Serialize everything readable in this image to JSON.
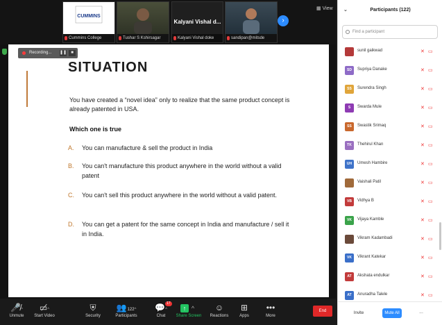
{
  "top_strip": {
    "tiles": [
      {
        "caption": "Cummins College"
      },
      {
        "caption": "Tushar S Kshirsagar"
      },
      {
        "caption": "Kalyani  Vishal doke"
      },
      {
        "caption": "sandipan@mitsde"
      }
    ],
    "name_tile": "Kalyani   Vishal d...",
    "view_label": "View"
  },
  "recording": {
    "label": "Recording..."
  },
  "slide": {
    "title": "SITUATION",
    "intro": "You have created a “novel idea” only to realize that the same product concept is already patented in USA.",
    "question": "Which one is true",
    "options": [
      {
        "letter": "A.",
        "text": "You can manufacture & sell the product in India"
      },
      {
        "letter": "B.",
        "text": "You can't manufacture this product anywhere in the world without a valid patent"
      },
      {
        "letter": "C.",
        "text": "You can't sell this product anywhere in the world without a valid patent."
      },
      {
        "letter": "D.",
        "text": "You can get a patent for the same concept in India and manufacture / sell it in India."
      }
    ]
  },
  "toolbar": {
    "unmute": "Unmute",
    "start_video": "Start Video",
    "security": "Security",
    "participants": "Participants",
    "participants_count": "122",
    "chat": "Chat",
    "chat_badge": "17",
    "share": "Share Screen",
    "reactions": "Reactions",
    "apps": "Apps",
    "more": "More",
    "end": "End"
  },
  "panel": {
    "title": "Participants (122)",
    "search_placeholder": "Find a participant",
    "participants": [
      {
        "initials": "",
        "name": "sunil gaikwad",
        "color": "#b43a3a"
      },
      {
        "initials": "SD",
        "name": "Supriya Danake",
        "color": "#8e6bc7"
      },
      {
        "initials": "SS",
        "name": "Surendra Singh",
        "color": "#e0a53a"
      },
      {
        "initials": "S",
        "name": "Swarda Mule",
        "color": "#8e3bb3"
      },
      {
        "initials": "SS",
        "name": "Swastik Srimaq",
        "color": "#c9682d"
      },
      {
        "initials": "TK",
        "name": "Thehirul Khan",
        "color": "#9a6fc0"
      },
      {
        "initials": "UH",
        "name": "Umesh Hambire",
        "color": "#3f73c9"
      },
      {
        "initials": "",
        "name": "Vaishali Patil",
        "color": "#a06a3a"
      },
      {
        "initials": "VB",
        "name": "Vidhya B",
        "color": "#c23b3b"
      },
      {
        "initials": "VK",
        "name": "Vijaya Kamble",
        "color": "#3aa34a"
      },
      {
        "initials": "",
        "name": "Vikram Kadambadi",
        "color": "#6b4a3a"
      },
      {
        "initials": "VK",
        "name": "Vikrant Katekar",
        "color": "#3a6fc9"
      },
      {
        "initials": "AT",
        "name": "Akshata  endulkar",
        "color": "#c23b3b"
      },
      {
        "initials": "AT",
        "name": "Anuradha Talele",
        "color": "#3a6fc9"
      }
    ],
    "invite": "Invite",
    "mute_all": "Mute All",
    "more": "..."
  }
}
